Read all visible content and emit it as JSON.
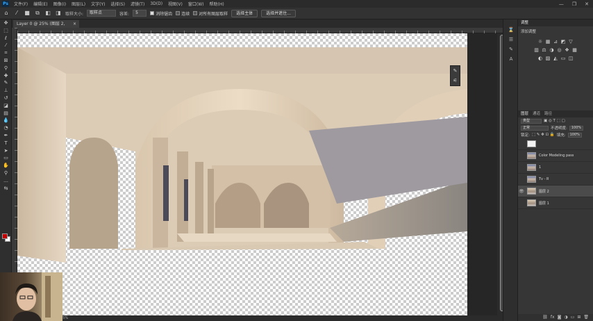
{
  "app": {
    "logo": "Ps",
    "menu": [
      "文件(F)",
      "编辑(E)",
      "图像(I)",
      "图层(L)",
      "文字(Y)",
      "选择(S)",
      "滤镜(T)",
      "3D(D)",
      "视图(V)",
      "窗口(W)",
      "帮助(H)"
    ],
    "window_controls": [
      "minimize-icon",
      "restore-icon",
      "close-icon"
    ]
  },
  "options_bar": {
    "mode_label": "取样大小:",
    "mode_value": "取样点",
    "tolerance_label": "容差:",
    "tolerance_value": "5",
    "anti_alias": "消除锯齿",
    "contiguous": "连续",
    "all_layers": "对所有图层取样",
    "subject_button": "选择主体",
    "select_mask_button": "选择并遮住..."
  },
  "document": {
    "tab_title": "Layer 0 @ 25% (图层 2, RGB/8)",
    "zoom": "25%"
  },
  "adjustments_panel": {
    "tab": "调整",
    "title": "添加调整"
  },
  "layers_panel": {
    "tabs": [
      "图层",
      "通道",
      "路径"
    ],
    "kind_filter": "类型",
    "blend_mode": "正常",
    "opacity_label": "不透明度:",
    "opacity_value": "100%",
    "lock_label": "锁定:",
    "fill_label": "填充:",
    "fill_value": "100%",
    "layers": [
      {
        "name": "",
        "thumb": "white",
        "visible": false,
        "selected": false
      },
      {
        "name": "Color Modeling pass",
        "thumb": "photo",
        "visible": false,
        "selected": false
      },
      {
        "name": "1",
        "thumb": "photo",
        "visible": false,
        "selected": false
      },
      {
        "name": "Tv - R",
        "thumb": "photo",
        "visible": false,
        "selected": false
      },
      {
        "name": "图层 2",
        "thumb": "arch",
        "visible": true,
        "selected": true
      },
      {
        "name": "图层 1",
        "thumb": "arch",
        "visible": false,
        "selected": false
      }
    ]
  },
  "colors": {
    "foreground": "#c00000",
    "background": "#ffffff",
    "app_bg": "#3a3a3a"
  }
}
